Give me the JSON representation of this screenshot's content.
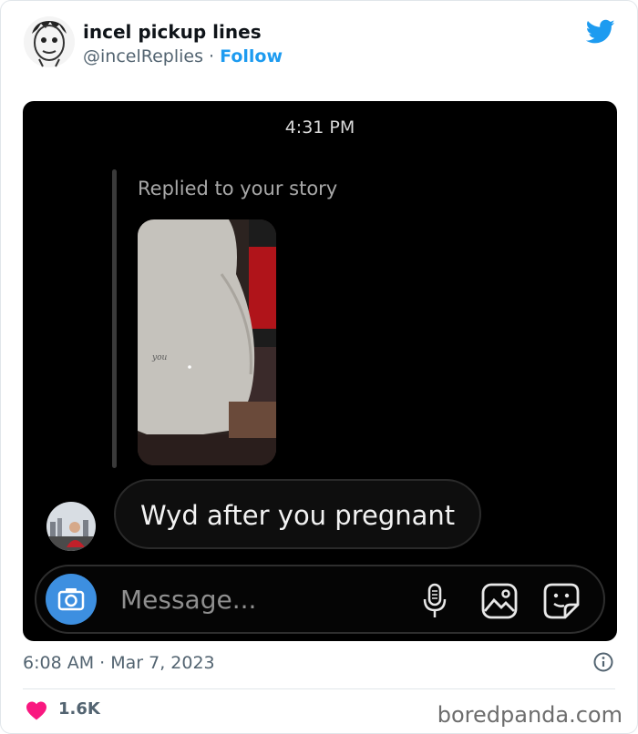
{
  "tweet": {
    "display_name": "incel pickup lines",
    "handle": "@incelReplies",
    "separator": "·",
    "follow_label": "Follow",
    "timestamp": "6:08 AM · Mar 7, 2023",
    "likes": "1.6K"
  },
  "screenshot": {
    "time": "4:31 PM",
    "replied_label": "Replied to your story",
    "message_text": "Wyd after you pregnant",
    "composer_placeholder": "Message...",
    "story_scribble": "you"
  },
  "watermark": "boredpanda.com",
  "colors": {
    "twitter_blue": "#1d9bf0",
    "heart_pink": "#f91880",
    "camera_blue": "#3d8fe0"
  },
  "icons": [
    "avatar-sketch",
    "twitter-bird-icon",
    "camera-icon",
    "microphone-icon",
    "image-icon",
    "sticker-icon",
    "info-icon",
    "heart-icon"
  ]
}
